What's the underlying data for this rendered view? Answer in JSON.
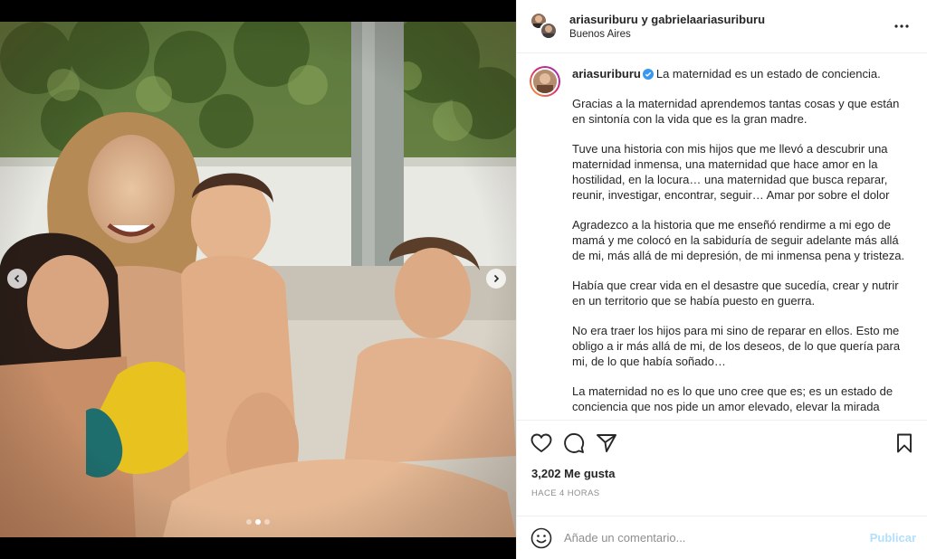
{
  "header": {
    "users": "ariasuriburu y gabrielaariasuriburu",
    "location": "Buenos Aires",
    "more_icon": "more-horizontal-icon"
  },
  "caption": {
    "username": "ariasuriburu",
    "verified": true,
    "first_line": "La maternidad es un estado de conciencia.",
    "paragraphs": [
      "Gracias a la maternidad aprendemos tantas cosas y que están en sintonía con la vida que es la gran madre.",
      "Tuve una historia con mis hijos que me llevó a descubrir una maternidad inmensa, una maternidad que hace amor en la hostilidad, en la locura… una maternidad que busca reparar, reunir, investigar, encontrar, seguir… Amar por sobre el dolor",
      "Agradezco a la historia que me enseñó rendirme a mi ego de mamá y me colocó en la sabiduría de seguir adelante más allá de mi, más allá de mi depresión, de mi inmensa pena y tristeza.",
      "Había que crear vida en el desastre que sucedía, crear y nutrir en un territorio que se había puesto en guerra.",
      "No era traer los hijos para mi sino de reparar en ellos. Esto me obligo a ir más allá de mi, de los deseos, de lo que quería para mi, de lo que había soñado…",
      "La maternidad no es lo que uno cree que es; es un estado de conciencia que nos pide un amor elevado, elevar la mirada"
    ]
  },
  "actions": {
    "like_icon": "heart-icon",
    "comment_icon": "comment-icon",
    "share_icon": "send-icon",
    "save_icon": "bookmark-icon"
  },
  "likes": "3,202 Me gusta",
  "time_ago": "HACE 4 HORAS",
  "comment": {
    "placeholder": "Añade un comentario...",
    "post_label": "Publicar",
    "emoji_icon": "emoji-smile-icon"
  },
  "carousel": {
    "prev_icon": "chevron-left-icon",
    "next_icon": "chevron-right-icon",
    "total": 3,
    "active_index": 1
  },
  "colors": {
    "link_disabled": "#b2dffc",
    "verified": "#3897f0",
    "secondary_text": "#8e8e8e"
  }
}
